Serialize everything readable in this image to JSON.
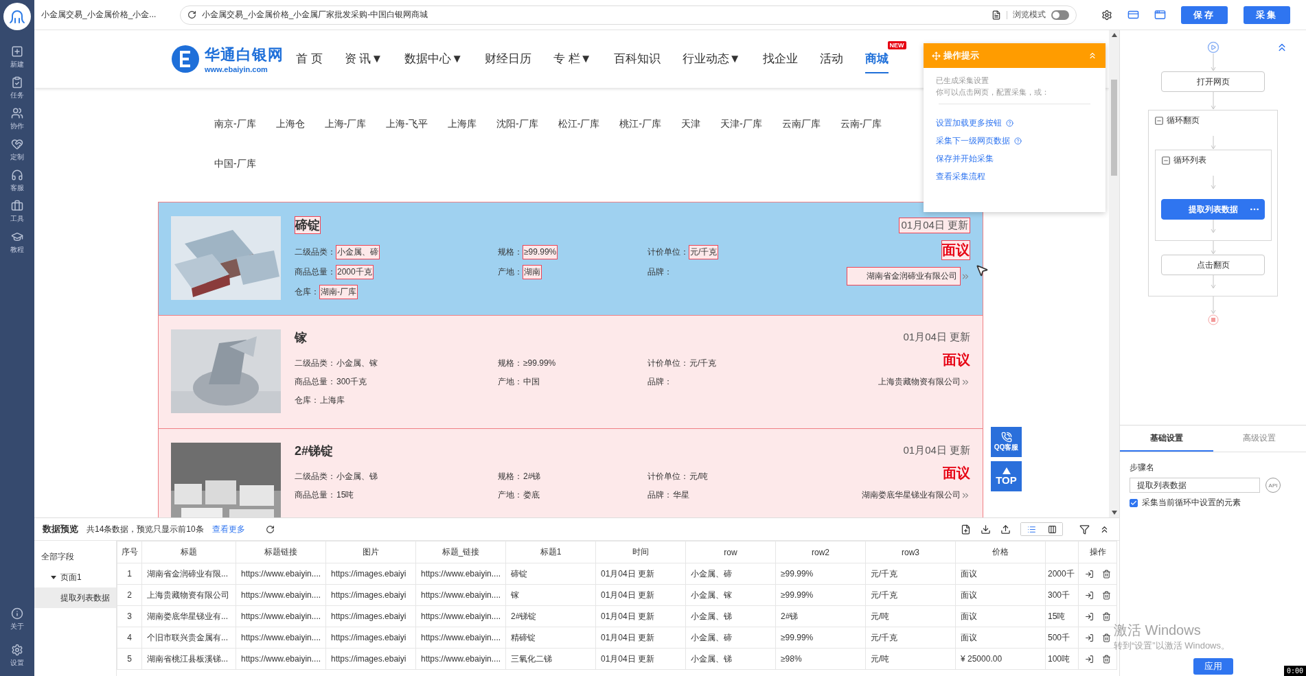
{
  "sidebar": {
    "items": [
      {
        "label": "新建",
        "kind": "new"
      },
      {
        "label": "任务",
        "kind": "task"
      },
      {
        "label": "协作",
        "kind": "team"
      },
      {
        "label": "定制",
        "kind": "custom"
      },
      {
        "label": "客服",
        "kind": "service"
      },
      {
        "label": "工具",
        "kind": "tools"
      },
      {
        "label": "教程",
        "kind": "tutorial"
      }
    ],
    "bottom_items": [
      {
        "label": "关于",
        "kind": "about"
      },
      {
        "label": "设置",
        "kind": "settings"
      }
    ]
  },
  "browser": {
    "tab_title": "小金属交易_小金属价格_小金...",
    "url": "小金属交易_小金属价格_小金属厂家批发采购-中国白银网商城",
    "browse_mode": {
      "label": "浏览模式",
      "on": false
    },
    "buttons": [
      "保存",
      "采集"
    ]
  },
  "site": {
    "logo": {
      "name": "华通白银网",
      "domain": "www.ebaiyin.com"
    },
    "nav": [
      {
        "label": "首 页",
        "selected": false
      },
      {
        "label": "资 讯▼",
        "selected": false
      },
      {
        "label": "数据中心▼",
        "selected": false
      },
      {
        "label": "财经日历",
        "selected": false
      },
      {
        "label": "专 栏▼",
        "selected": false
      },
      {
        "label": "百科知识",
        "selected": false
      },
      {
        "label": "行业动态▼",
        "selected": false
      },
      {
        "label": "找企业",
        "selected": false
      },
      {
        "label": "活动",
        "selected": false
      },
      {
        "label": "商城",
        "selected": true,
        "badge": "NEW"
      }
    ],
    "warehouse_rows": [
      [
        "南京-厂库",
        "上海仓",
        "上海-厂库",
        "上海-飞平",
        "上海库",
        "沈阳-厂库",
        "松江-厂库",
        "桃江-厂库",
        "天津",
        "天津-厂库",
        "云南厂库",
        "云南-厂库"
      ],
      [
        "中国-厂库"
      ]
    ],
    "products": [
      {
        "title": "碲锭",
        "date": "01月04日 更新",
        "price": "面议",
        "company": "湖南省金润碲业有限公司",
        "selected": true,
        "fields": [
          {
            "label": "二级品类：",
            "value": "小金属、碲"
          },
          {
            "label": "规格：",
            "value": "≥99.99%"
          },
          {
            "label": "计价单位：",
            "value": "元/千克"
          },
          {
            "label": "商品总量：",
            "value": "2000千克"
          },
          {
            "label": "产地：",
            "value": "湖南"
          },
          {
            "label": "品牌："
          },
          {
            "label": "仓库：",
            "value": "湖南-厂库"
          }
        ]
      },
      {
        "title": "镓",
        "date": "01月04日 更新",
        "price": "面议",
        "company": "上海贵藏物资有限公司",
        "selected": false,
        "fields": [
          {
            "label": "二级品类：",
            "value": "小金属、镓"
          },
          {
            "label": "规格：",
            "value": "≥99.99%"
          },
          {
            "label": "计价单位：",
            "value": "元/千克"
          },
          {
            "label": "商品总量：",
            "value": "300千克"
          },
          {
            "label": "产地：",
            "value": "中国"
          },
          {
            "label": "品牌："
          },
          {
            "label": "仓库：",
            "value": "上海库"
          }
        ]
      },
      {
        "title": "2#锑锭",
        "date": "01月04日 更新",
        "price": "面议",
        "company": "湖南娄底华星锑业有限公司",
        "selected": false,
        "fields": [
          {
            "label": "二级品类：",
            "value": "小金属、锑"
          },
          {
            "label": "规格：",
            "value": "2#锑"
          },
          {
            "label": "计价单位：",
            "value": "元/吨"
          },
          {
            "label": "商品总量：",
            "value": "15吨"
          },
          {
            "label": "产地：",
            "value": "娄底"
          },
          {
            "label": "品牌：",
            "value": "华星"
          }
        ]
      }
    ],
    "tips": {
      "title": "操作提示",
      "intro": [
        "已生成采集设置",
        "你可以点击网页，配置采集，或："
      ],
      "links": [
        {
          "label": "设置加载更多按钮",
          "help": true
        },
        {
          "label": "采集下一级网页数据",
          "help": true
        },
        {
          "label": "保存并开始采集",
          "help": false
        },
        {
          "label": "查看采集流程",
          "help": false
        }
      ]
    },
    "float_buttons": [
      {
        "kind": "qq",
        "label": "QQ客服"
      },
      {
        "kind": "top",
        "label": "TOP"
      }
    ]
  },
  "flow": [
    {
      "kind": "start"
    },
    {
      "kind": "step",
      "label": "打开网页",
      "selected": false
    },
    {
      "kind": "loop",
      "label": "循环翻页",
      "expanded": true,
      "children": [
        {
          "kind": "loop",
          "label": "循环列表",
          "expanded": true,
          "children": [
            {
              "kind": "step",
              "label": "提取列表数据",
              "selected": true
            }
          ]
        },
        {
          "kind": "step",
          "label": "点击翻页",
          "selected": false
        }
      ]
    },
    {
      "kind": "end"
    }
  ],
  "settings": {
    "tabs": [
      {
        "label": "基础设置",
        "selected": true
      },
      {
        "label": "高级设置",
        "selected": false
      }
    ],
    "field_label": "步骤名",
    "field_value": "提取列表数据",
    "api_badge": "API",
    "checkbox": {
      "label": "采集当前循环中设置的元素",
      "checked": true
    },
    "apply": "应用"
  },
  "preview": {
    "title": "数据预览",
    "summary": "共14条数据，预览只显示前10条",
    "more": "查看更多",
    "view_modes": [
      {
        "kind": "list",
        "selected": true
      },
      {
        "kind": "columns",
        "selected": false
      }
    ],
    "tree": {
      "label": "全部字段",
      "selected": false,
      "children": [
        {
          "label": "页面1",
          "selected": false,
          "expanded": true,
          "children": [
            {
              "label": "提取列表数据",
              "selected": true
            }
          ]
        }
      ]
    },
    "columns": [
      {
        "kind": "index",
        "label": "序号"
      },
      {
        "kind": "data",
        "label": "标题"
      },
      {
        "kind": "data",
        "label": "标题链接"
      },
      {
        "kind": "data",
        "label": "图片"
      },
      {
        "kind": "data",
        "label": "标题_链接"
      },
      {
        "kind": "data",
        "label": "标题1"
      },
      {
        "kind": "data",
        "label": "时间"
      },
      {
        "kind": "data",
        "label": "row"
      },
      {
        "kind": "data",
        "label": "row2"
      },
      {
        "kind": "data",
        "label": "row3"
      },
      {
        "kind": "data",
        "label": "价格"
      },
      {
        "kind": "data"
      },
      {
        "kind": "actions",
        "label": "操作"
      }
    ],
    "rows": [
      [
        "1",
        "湖南省金润碲业有限...",
        "https://www.ebaiyin....",
        "https://images.ebaiyi",
        "https://www.ebaiyin....",
        "碲锭",
        "01月04日 更新",
        "小金属、碲",
        "≥99.99%",
        "元/千克",
        "面议",
        "2000千"
      ],
      [
        "2",
        "上海贵藏物资有限公司",
        "https://www.ebaiyin....",
        "https://images.ebaiyi",
        "https://www.ebaiyin....",
        "镓",
        "01月04日 更新",
        "小金属、镓",
        "≥99.99%",
        "元/千克",
        "面议",
        "300千"
      ],
      [
        "3",
        "湖南娄底华星锑业有...",
        "https://www.ebaiyin....",
        "https://images.ebaiyi",
        "https://www.ebaiyin....",
        "2#锑锭",
        "01月04日 更新",
        "小金属、锑",
        "2#锑",
        "元/吨",
        "面议",
        "15吨"
      ],
      [
        "4",
        "个旧市联兴贵金属有...",
        "https://www.ebaiyin....",
        "https://images.ebaiyi",
        "https://www.ebaiyin....",
        "精碲锭",
        "01月04日 更新",
        "小金属、碲",
        "≥99.99%",
        "元/千克",
        "面议",
        "500千"
      ],
      [
        "5",
        "湖南省桃江县板溪锑...",
        "https://www.ebaiyin....",
        "https://images.ebaiyi",
        "https://www.ebaiyin....",
        "三氧化二锑",
        "01月04日 更新",
        "小金属、锑",
        "≥98%",
        "元/吨",
        "¥ 25000.00",
        "100吨"
      ]
    ]
  },
  "os_notice": {
    "title": "激活 Windows",
    "text": "转到“设置”以激活 Windows。"
  },
  "timer": "0:00"
}
